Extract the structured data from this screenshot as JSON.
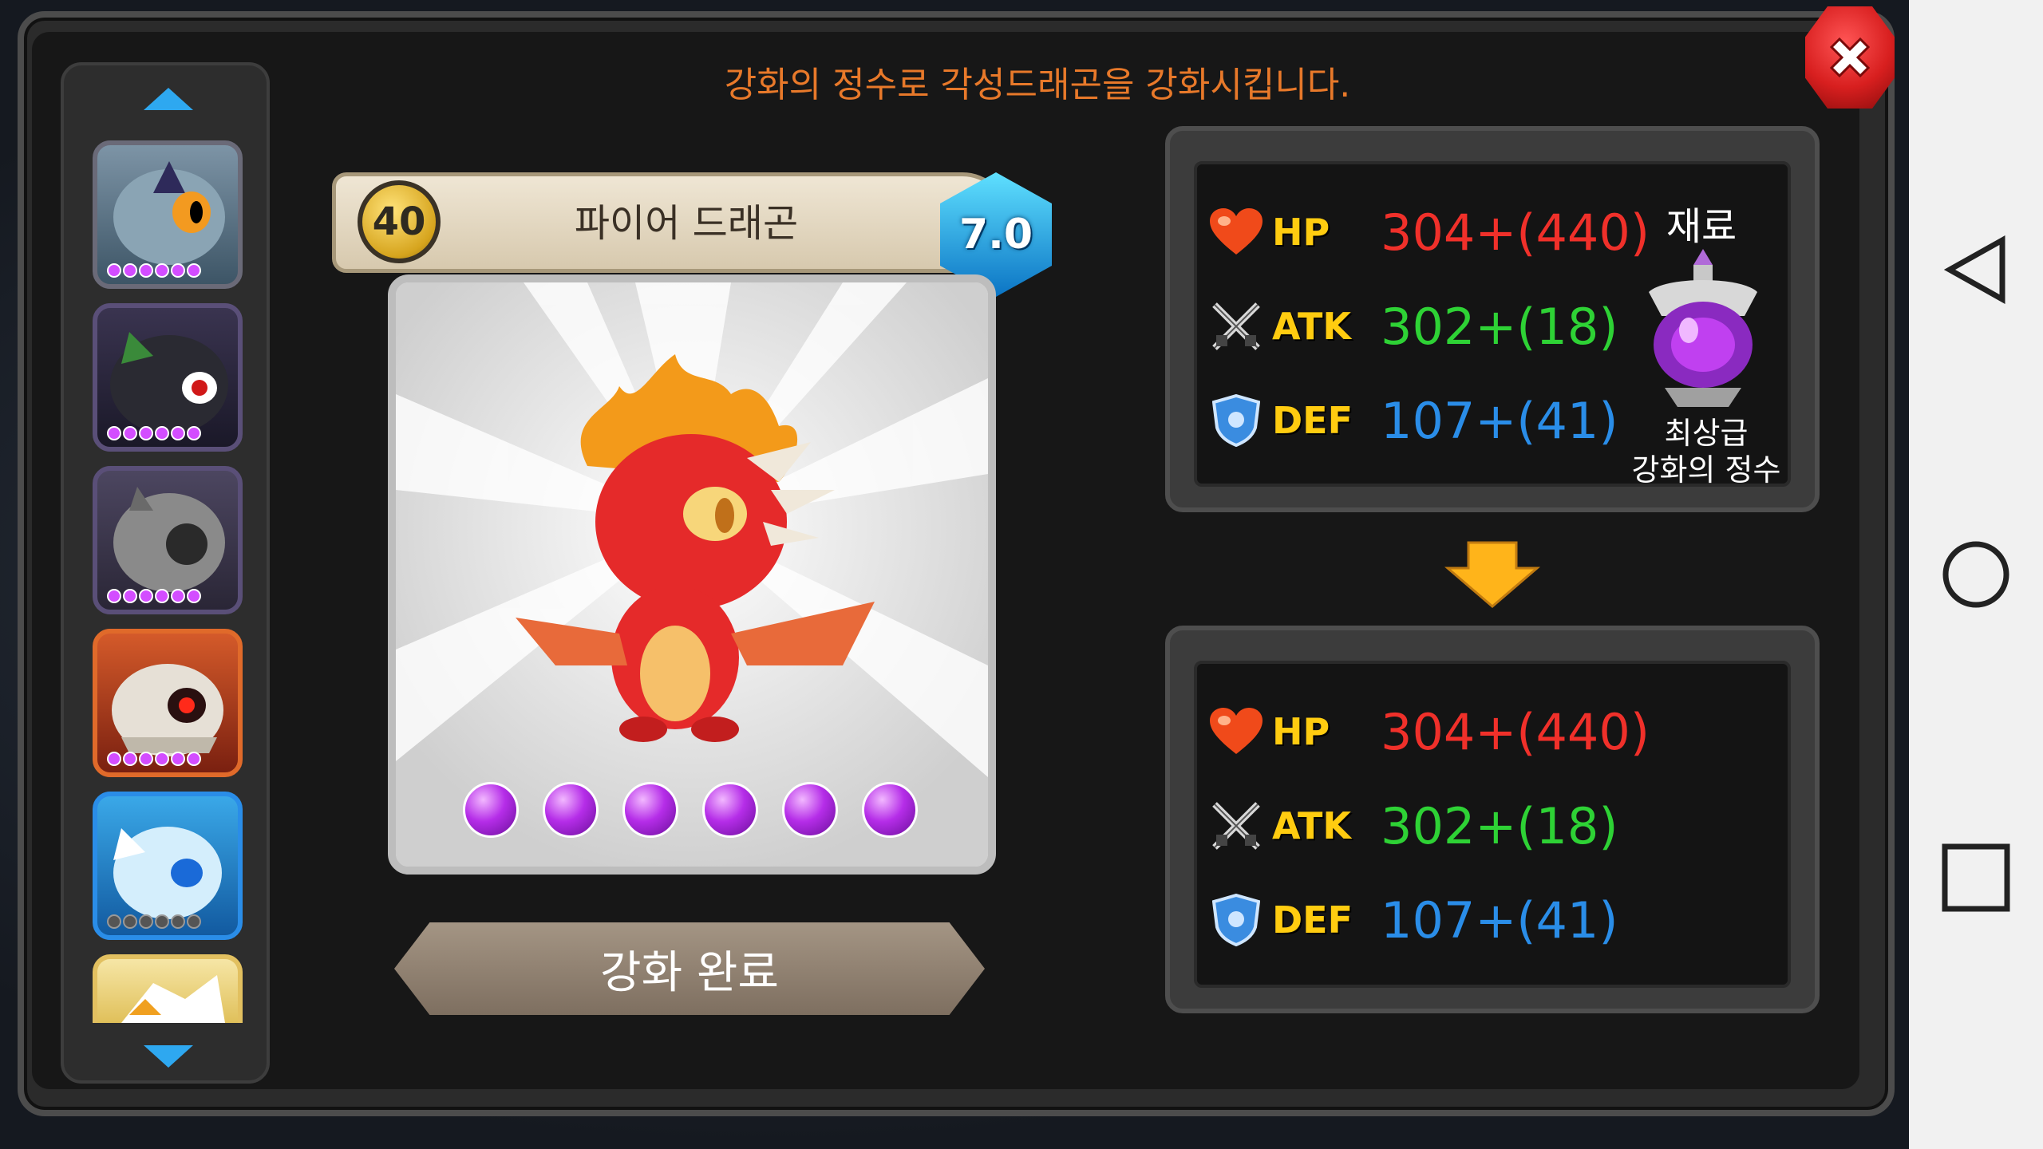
{
  "dialog": {
    "info_text": "강화의 정수로 각성드래곤을 강화시킵니다.",
    "close_icon": "close-icon"
  },
  "dragon": {
    "level": "40",
    "name": "파이어 드래곤",
    "grade": "7.0",
    "orb_count": 6
  },
  "complete_button": "강화 완료",
  "before": {
    "hp_label": "HP",
    "hp_value": "304+(440)",
    "atk_label": "ATK",
    "atk_value": "302+(18)",
    "def_label": "DEF",
    "def_value": "107+(41)"
  },
  "after": {
    "hp_label": "HP",
    "hp_value": "304+(440)",
    "atk_label": "ATK",
    "atk_value": "302+(18)",
    "def_label": "DEF",
    "def_value": "107+(41)"
  },
  "material": {
    "label": "재료",
    "name_line1": "최상급",
    "name_line2": "강화의 정수"
  },
  "colors": {
    "hp": "#f0302a",
    "atk": "#2ed235",
    "def": "#2a8de8",
    "info": "#e8792a",
    "stat_label": "#ffcc10"
  },
  "side_list": {
    "thumbnails": [
      {
        "name": "dragon-thumb-1",
        "stars": 6
      },
      {
        "name": "dragon-thumb-2",
        "stars": 6
      },
      {
        "name": "dragon-thumb-3",
        "stars": 6
      },
      {
        "name": "dragon-thumb-4",
        "stars": 6
      },
      {
        "name": "dragon-thumb-5",
        "stars": 6
      },
      {
        "name": "dragon-thumb-6",
        "stars": 0
      }
    ]
  },
  "system_nav": [
    "back-icon",
    "home-icon",
    "recents-icon"
  ]
}
